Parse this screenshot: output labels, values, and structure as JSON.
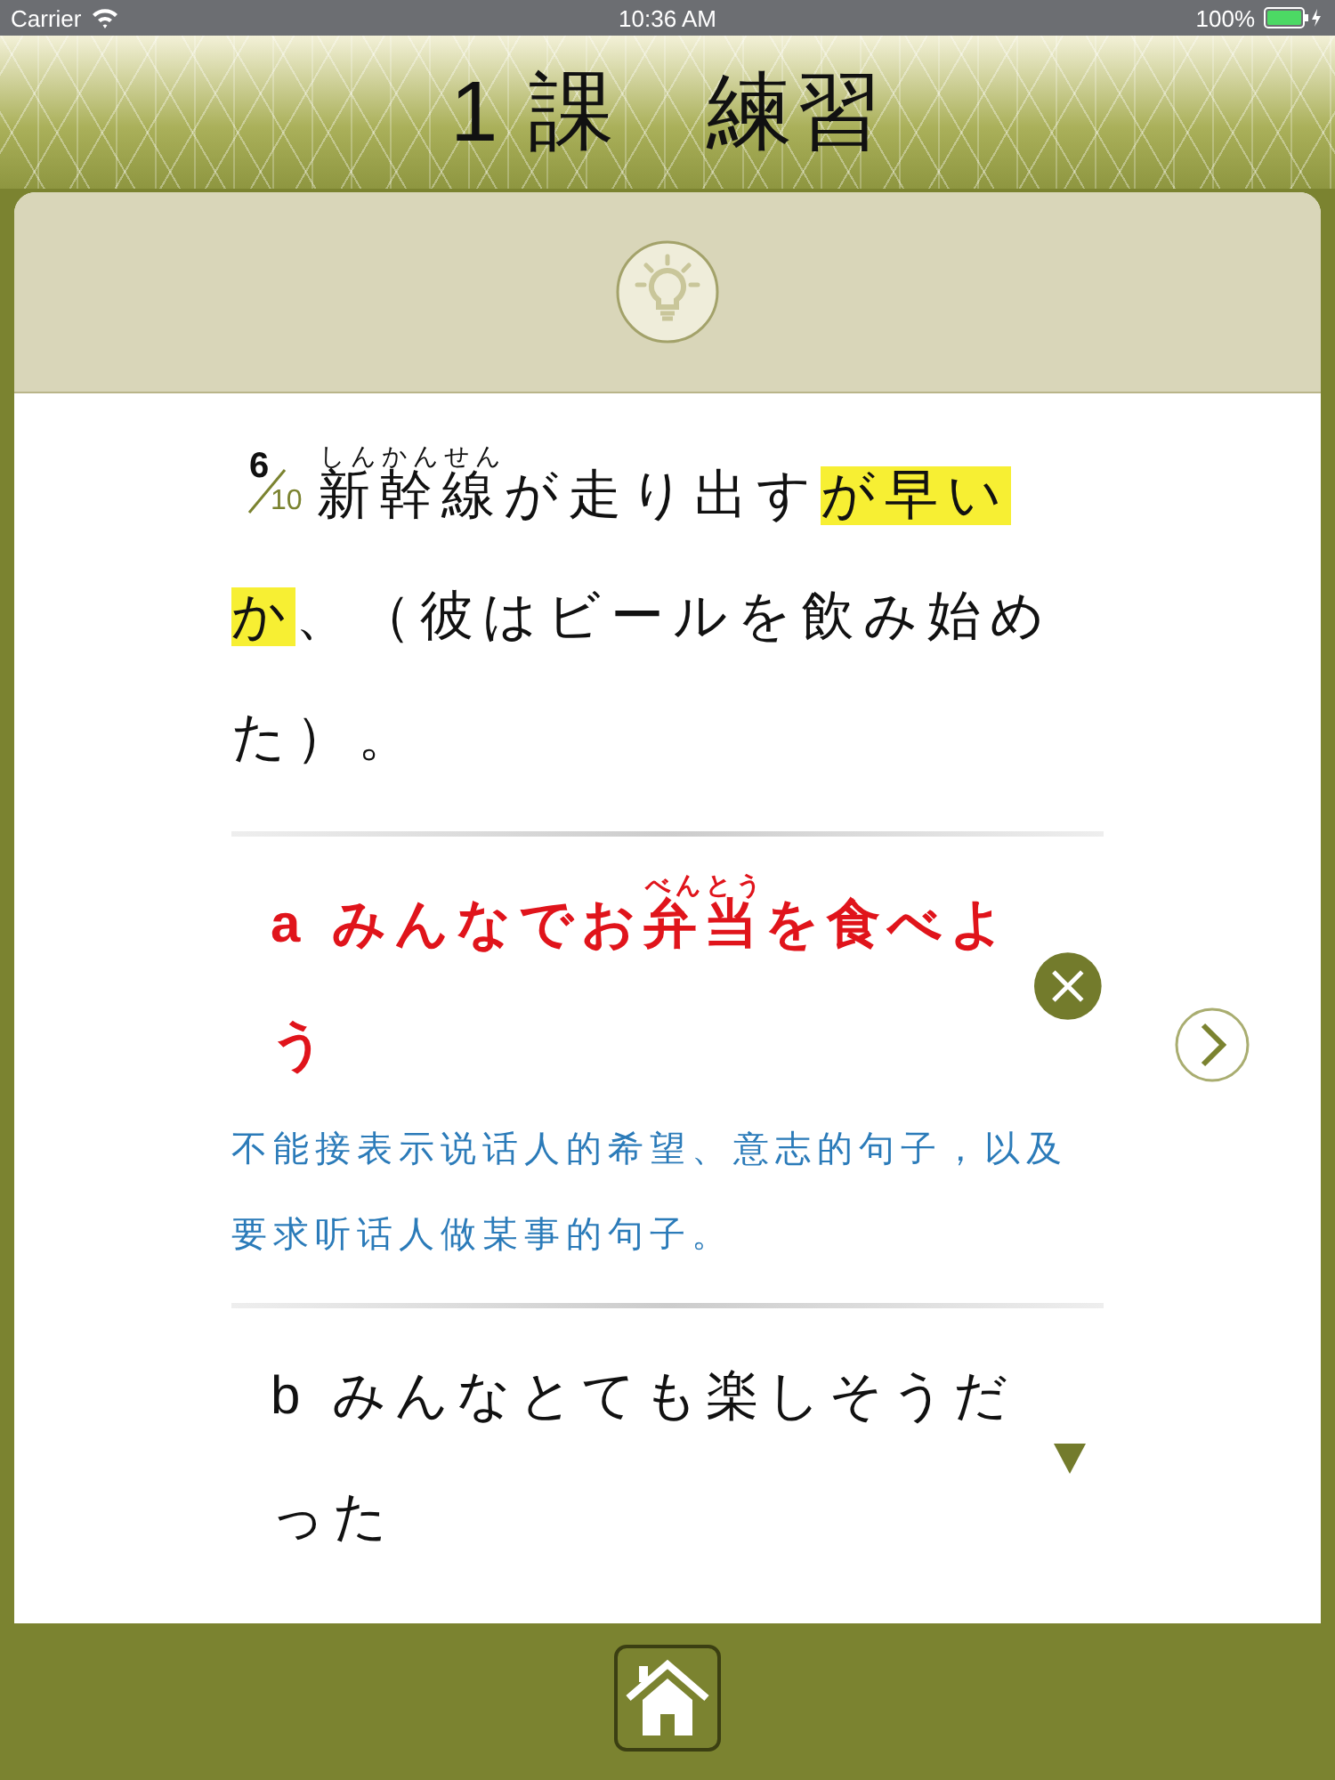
{
  "status_bar": {
    "carrier": "Carrier",
    "time": "10:36 AM",
    "battery": "100%"
  },
  "header": {
    "title": "1 課　練習"
  },
  "question": {
    "counter": {
      "current": "6",
      "total": "10"
    },
    "parts": [
      {
        "text": "新幹線",
        "ruby": "しんかんせん",
        "highlighted": false
      },
      {
        "text": "が走り出す",
        "highlighted": false
      },
      {
        "text": "が早いか",
        "highlighted": true
      },
      {
        "text": "、（彼はビールを飲み始めた）。",
        "highlighted": false
      }
    ]
  },
  "options": [
    {
      "letter": "a",
      "wrong": true,
      "expanded": true,
      "parts": [
        {
          "text": "みんなでお"
        },
        {
          "text": "弁当",
          "ruby": "べんとう"
        },
        {
          "text": "を食べよう"
        }
      ],
      "explanation": "不能接表示说话人的希望、意志的句子，以及要求听话人做某事的句子。"
    },
    {
      "letter": "b",
      "wrong": false,
      "expanded": false,
      "parts": [
        {
          "text": "みんなとても楽しそうだった"
        }
      ]
    }
  ]
}
